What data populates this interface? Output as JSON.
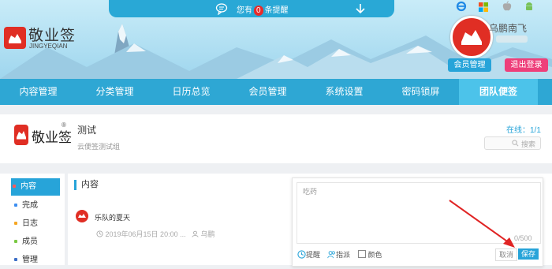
{
  "colors": {
    "accent": "#27a4d9",
    "nav": "#2ea7d4",
    "nav_active": "#4cc3ea",
    "brand_red": "#e02e24",
    "logout": "#ee3f7a"
  },
  "notification": {
    "prefix": "您有",
    "count": "0",
    "suffix": "条提醒"
  },
  "brand": {
    "name": "敬业签",
    "pinyin": "JINGYEQIAN"
  },
  "platforms": [
    "ie-icon",
    "apple-icon",
    "android-icon"
  ],
  "user": {
    "name": "乌鹏南飞",
    "member_button": "会员管理",
    "logout_button": "退出登录"
  },
  "nav": [
    {
      "label": "内容管理"
    },
    {
      "label": "分类管理"
    },
    {
      "label": "日历总览"
    },
    {
      "label": "会员管理"
    },
    {
      "label": "系统设置"
    },
    {
      "label": "密码锁屏"
    },
    {
      "label": "团队便签",
      "active": true
    }
  ],
  "group": {
    "logo_text": "敬业签",
    "title": "测试",
    "description": "云便签测试组",
    "online": "在线：1/1",
    "search_placeholder": "搜索"
  },
  "sidebar": [
    {
      "label": "内容",
      "dot": "#ff5a5a",
      "active": true
    },
    {
      "label": "完成",
      "dot": "#3d8ef0"
    },
    {
      "label": "日志",
      "dot": "#f5a623"
    },
    {
      "label": "成员",
      "dot": "#7ac943"
    },
    {
      "label": "管理",
      "dot": "#3d6fc7"
    }
  ],
  "content": {
    "heading": "内容",
    "post": {
      "title": "乐队的夏天",
      "date": "2019年06月15日 20:00 ...",
      "user": "乌鹏"
    }
  },
  "note": {
    "placeholder": "吃药",
    "count": "0/500",
    "tools": {
      "remind": "提醒",
      "assign": "指派",
      "color": "颜色"
    },
    "cancel": "取消",
    "save": "保存"
  }
}
